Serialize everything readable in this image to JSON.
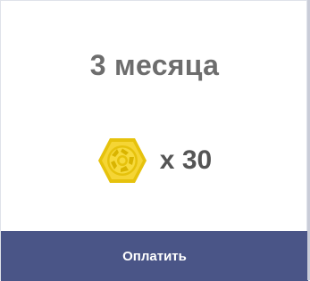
{
  "plan": {
    "period": "3 месяца",
    "currency_icon": "gold-hexagon-coin",
    "amount": "x 30",
    "accent_color": "#4a5587",
    "coin_color": "#e6c20c"
  },
  "actions": {
    "pay_label": "Оплатить"
  }
}
